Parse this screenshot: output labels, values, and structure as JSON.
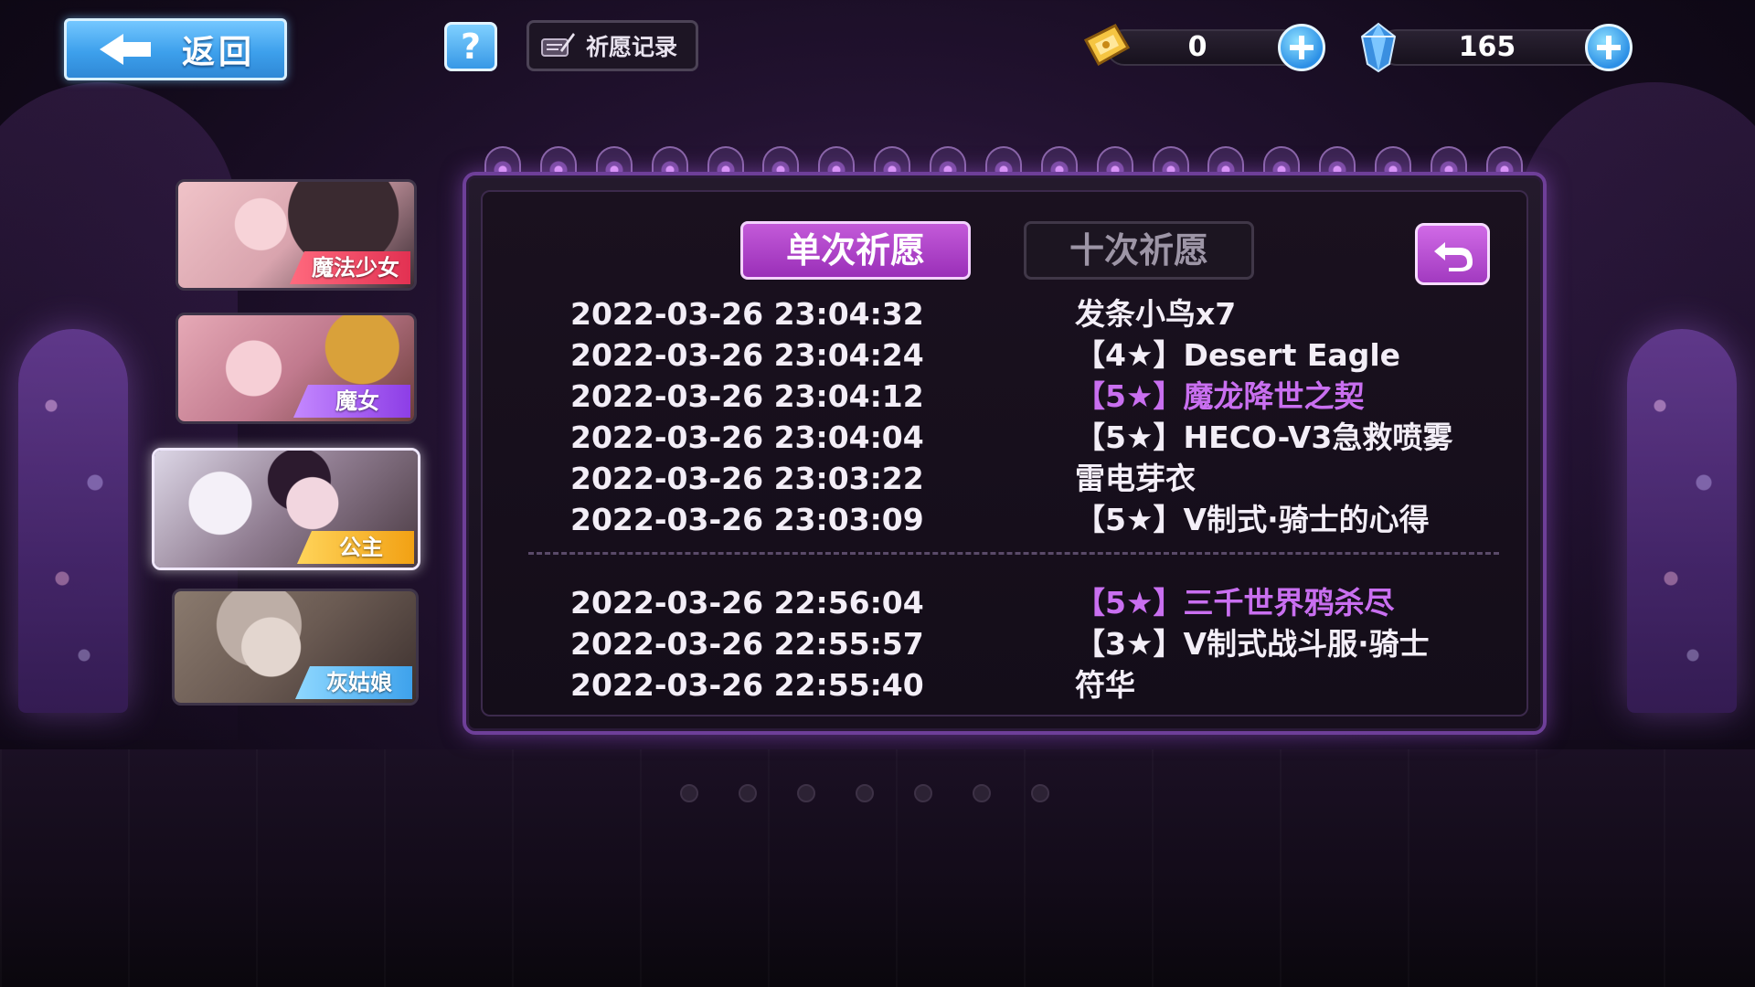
{
  "top_bar": {
    "back_label": "返回",
    "help_label": "?",
    "record_label": "祈愿记录",
    "gold_value": "0",
    "crystal_value": "165"
  },
  "characters": [
    {
      "label": "魔法少女",
      "tag_color": "#e23152"
    },
    {
      "label": "魔女",
      "tag_color": "#8d3ee6"
    },
    {
      "label": "公主",
      "tag_color": "#f2a114"
    },
    {
      "label": "灰姑娘",
      "tag_color": "#3ea2ec"
    }
  ],
  "panel": {
    "tab_single": "单次祈愿",
    "tab_ten": "十次祈愿",
    "records": [
      {
        "time": "2022-03-26 23:04:32",
        "item": "发条小鸟x7"
      },
      {
        "time": "2022-03-26 23:04:24",
        "item": "【4★】Desert Eagle"
      },
      {
        "time": "2022-03-26 23:04:12",
        "item": "【5★】魔龙降世之契"
      },
      {
        "time": "2022-03-26 23:04:04",
        "item": "【5★】HECO-V3急救喷雾"
      },
      {
        "time": "2022-03-26 23:03:22",
        "item": "雷电芽衣"
      },
      {
        "time": "2022-03-26 23:03:09",
        "item": "【5★】V制式·骑士的心得"
      },
      {
        "time": "2022-03-26 22:56:04",
        "item": "【5★】三千世界鸦杀尽"
      },
      {
        "time": "2022-03-26 22:55:57",
        "item": "【3★】V制式战斗服·骑士"
      },
      {
        "time": "2022-03-26 22:55:40",
        "item": "符华"
      }
    ]
  },
  "colors": {
    "accent_purple": "#c35ad9",
    "highlight_text": "#c96ff0",
    "button_blue": "#3da0ec"
  }
}
